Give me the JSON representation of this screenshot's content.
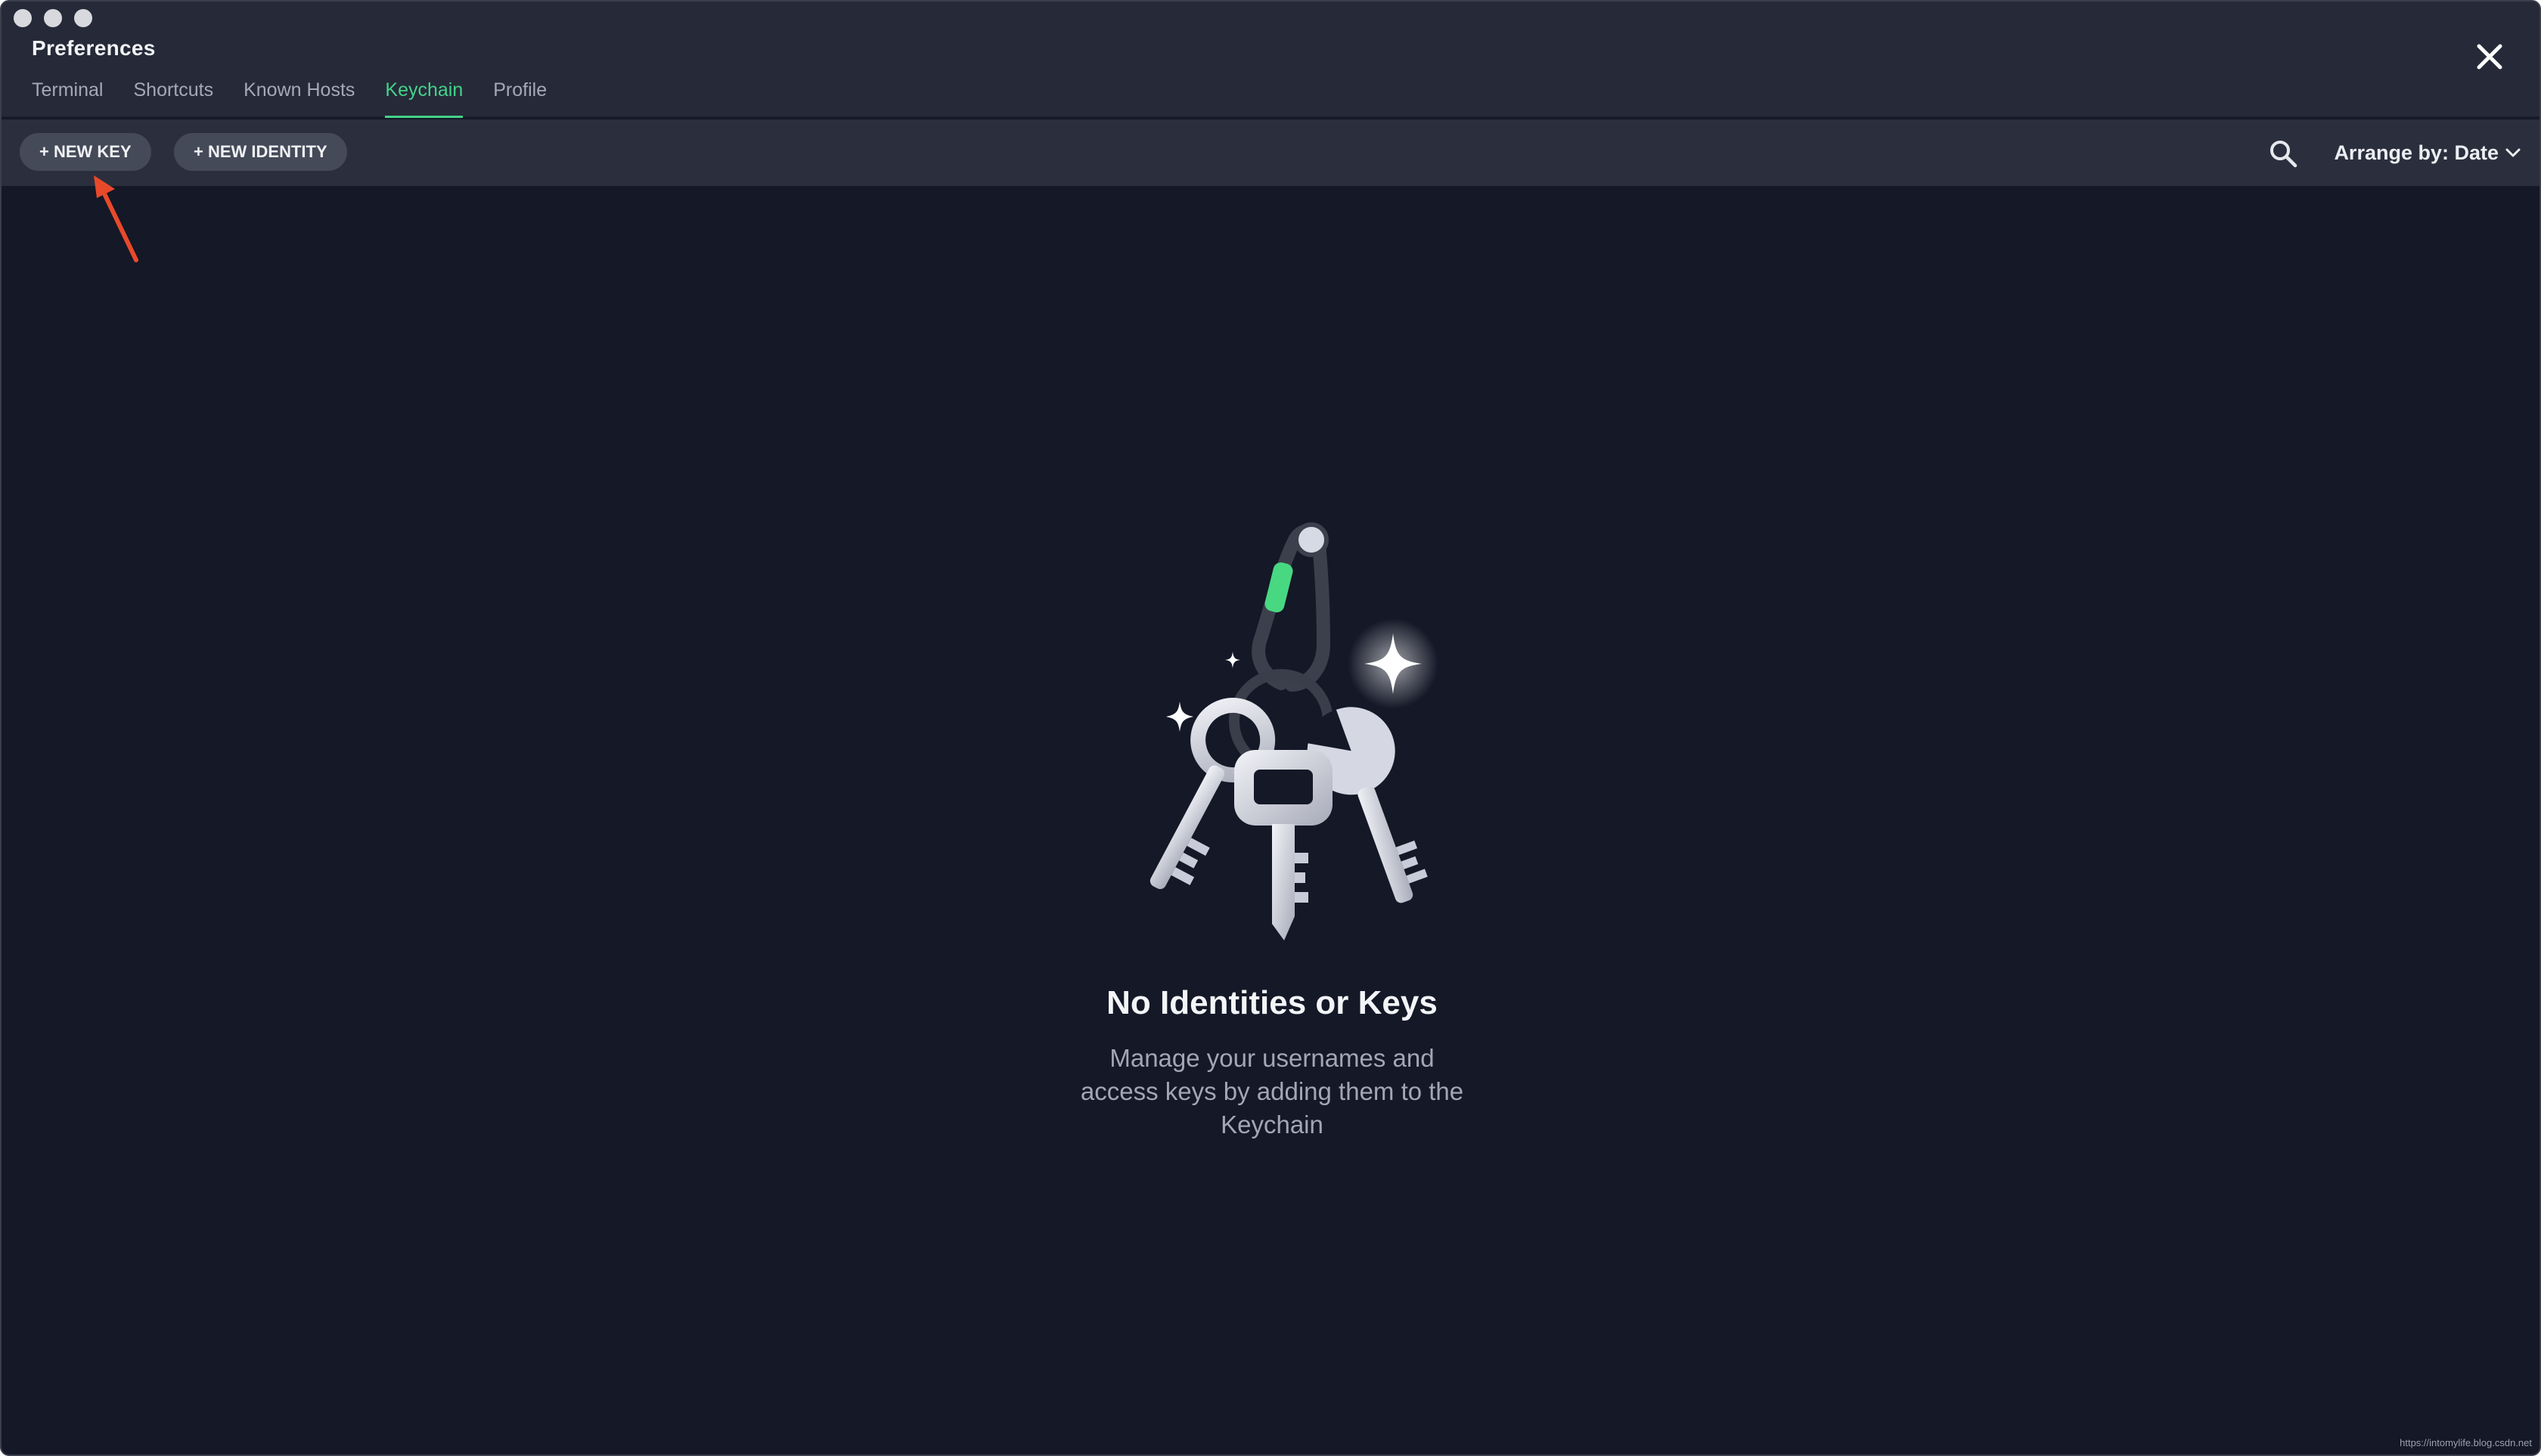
{
  "window": {
    "title": "Preferences",
    "close_icon": "close-icon"
  },
  "tabs": [
    {
      "label": "Terminal",
      "active": false
    },
    {
      "label": "Shortcuts",
      "active": false
    },
    {
      "label": "Known Hosts",
      "active": false
    },
    {
      "label": "Keychain",
      "active": true
    },
    {
      "label": "Profile",
      "active": false
    }
  ],
  "toolbar": {
    "new_key_label": "+ NEW KEY",
    "new_identity_label": "+ NEW IDENTITY",
    "search_icon": "search-icon",
    "arrange_label": "Arrange by: Date",
    "arrange_icon": "chevron-down-icon"
  },
  "empty_state": {
    "illustration": "keyring-illustration",
    "title": "No Identities or Keys",
    "description": "Manage your usernames and access keys by adding them to the Keychain"
  },
  "annotation": {
    "icon": "red-arrow-annotation"
  },
  "watermark": "https://intomylife.blog.csdn.net",
  "colors": {
    "background": "#141827",
    "titlebar": "#262a38",
    "toolbar": "#2b2f3d",
    "accent": "#44d28a",
    "annotation": "#e8492b"
  }
}
